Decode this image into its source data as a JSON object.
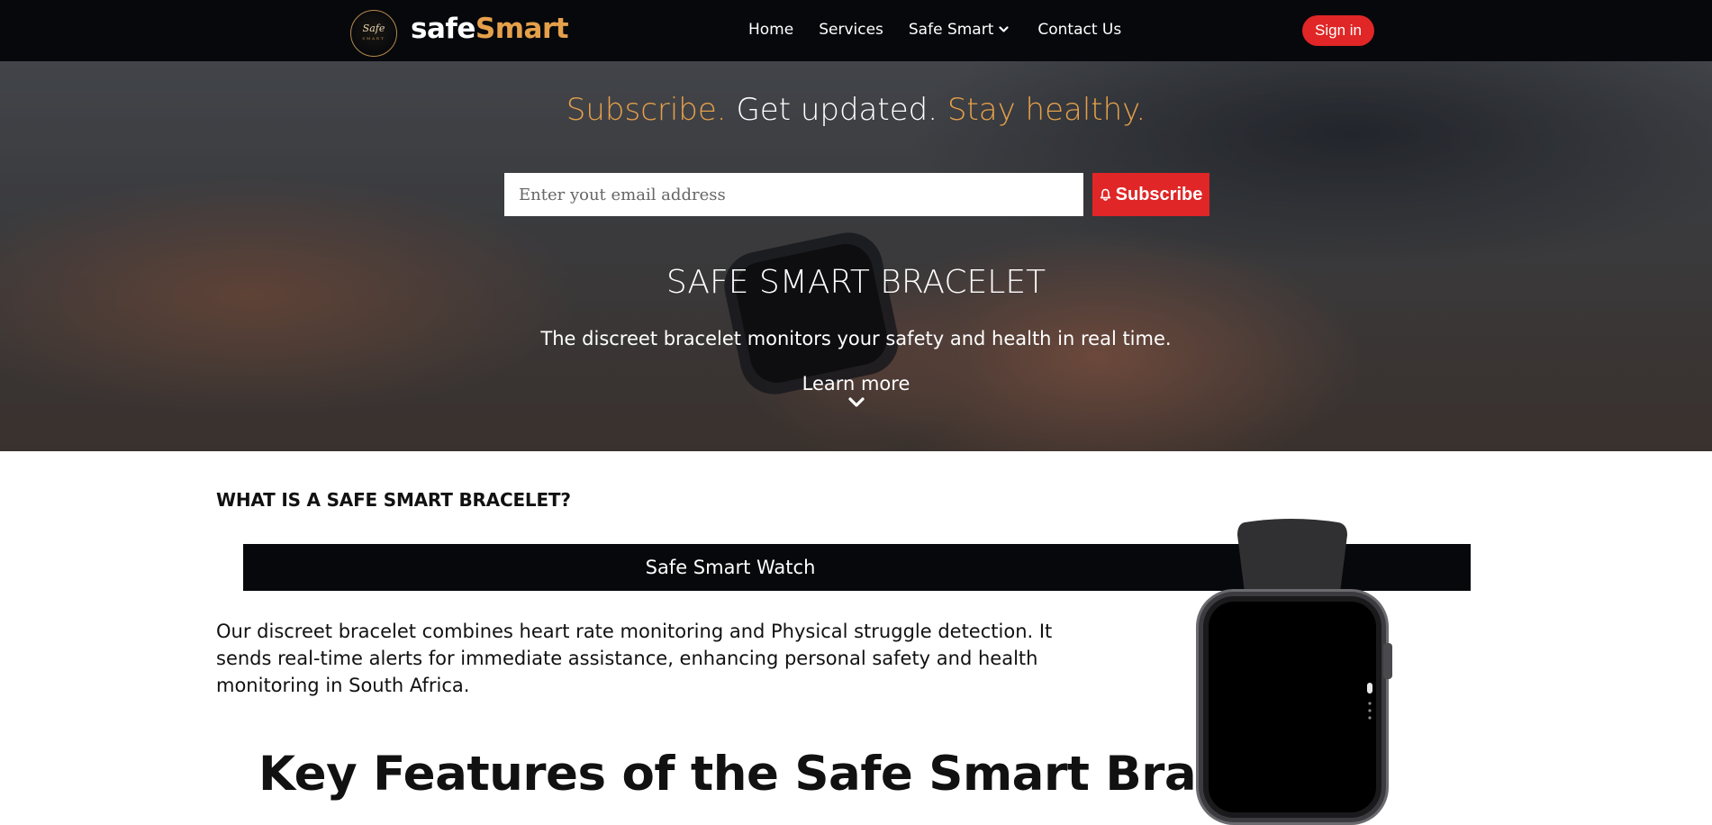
{
  "navbar": {
    "logo_text": "Safe",
    "logo_subtext": "SMART",
    "brand_part1": "safe",
    "brand_part2": "Smart",
    "links": [
      "Home",
      "Services",
      "Safe Smart",
      "Contact Us"
    ],
    "signin_label": "Sign in"
  },
  "hero": {
    "tagline_part1": "Subscribe.",
    "tagline_part2": "Get updated.",
    "tagline_part3": "Stay healthy.",
    "email_placeholder": "Enter yout email address",
    "subscribe_label": "Subscribe",
    "title": "SAFE SMART BRACELET",
    "description": "The discreet bracelet monitors your safety and health in real time.",
    "learn_more": "Learn more"
  },
  "content": {
    "section_heading": "WHAT IS A SAFE SMART BRACELET?",
    "bar_label": "Safe Smart Watch",
    "body_text": "Our discreet bracelet combines heart rate monitoring and Physical struggle detection. It sends real-time alerts for immediate assistance, enhancing personal safety and health monitoring in South Africa.",
    "features_heading": "Key Features of the Safe Smart Bracelet"
  },
  "colors": {
    "accent_red": "#e02626",
    "brand_gold": "#e5a04a",
    "nav_background": "#07080c"
  },
  "icons": {
    "dropdown": "chevron-down-icon",
    "bell": "bell-icon",
    "learn_more": "chevron-down-icon"
  }
}
